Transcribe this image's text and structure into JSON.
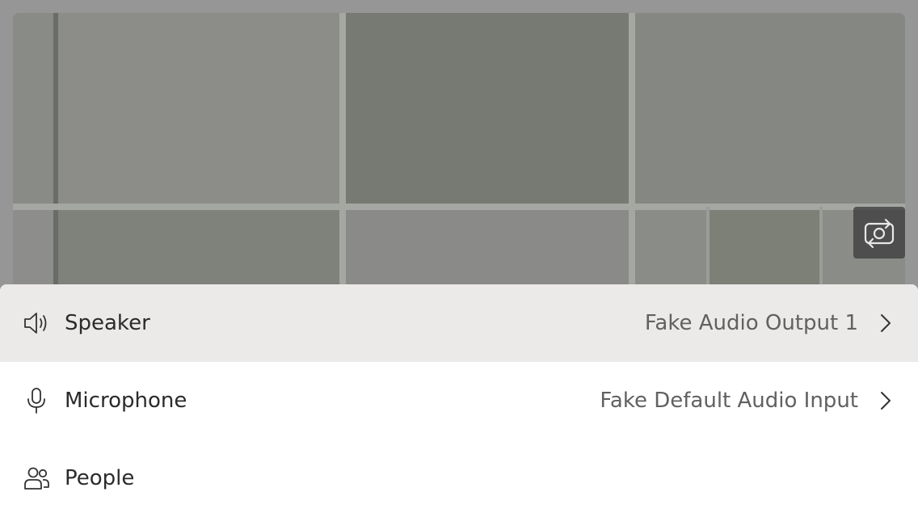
{
  "camera": {
    "switch_icon": "camera-switch-icon"
  },
  "device_menu": {
    "items": [
      {
        "label": "Speaker",
        "value": "Fake Audio Output 1",
        "icon": "speaker-icon"
      },
      {
        "label": "Microphone",
        "value": "Fake Default Audio Input",
        "icon": "microphone-icon"
      },
      {
        "label": "People",
        "icon": "people-icon"
      }
    ]
  },
  "colors": {
    "overlay": "#969696",
    "selected_row": "#ebeae8",
    "sheet": "#ffffff"
  }
}
